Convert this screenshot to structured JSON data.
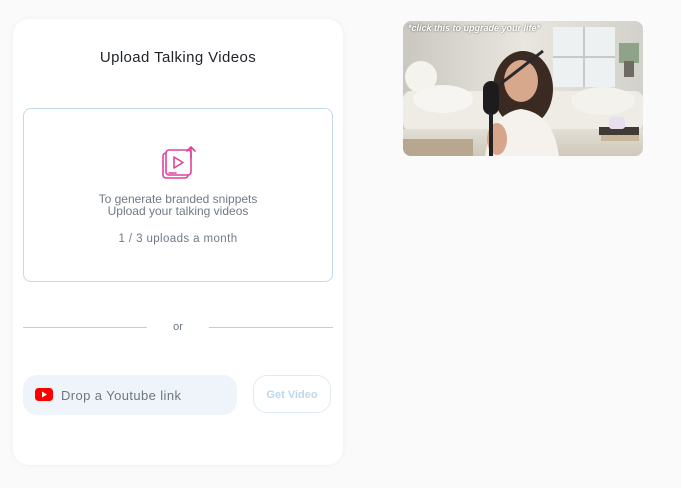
{
  "upload_card": {
    "title": "Upload Talking Videos",
    "dropzone": {
      "line1": "To generate branded snippets",
      "line2": "Upload your talking videos",
      "quota": "1 / 3 uploads a month"
    },
    "or_label": "or",
    "youtube_input": {
      "value": "",
      "placeholder": "Drop a Youtube link"
    },
    "get_video_label": "Get Video"
  },
  "video_thumbnail": {
    "caption": "*click this to upgrade your life*"
  },
  "icons": {
    "upload": "video-upload-icon",
    "youtube": "youtube-icon"
  },
  "colors": {
    "accent_pink": "#e0429a",
    "youtube_red": "#ff0000",
    "dropzone_border": "#c3dbe9",
    "input_bg": "#eef4fa"
  }
}
